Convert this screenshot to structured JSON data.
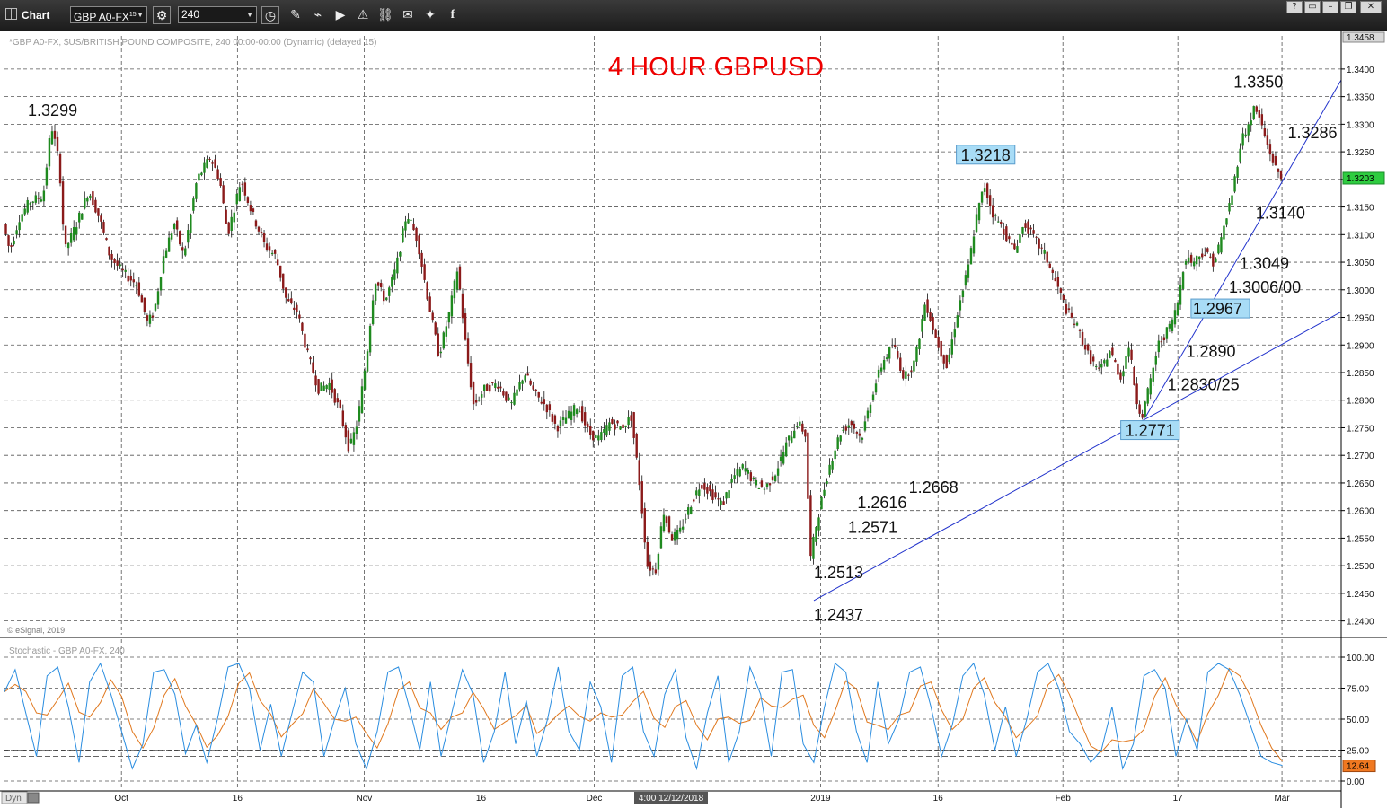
{
  "toolbar": {
    "title": "Chart",
    "symbol": "GBP A0-FX",
    "symbol_superscript": "15",
    "interval": "240",
    "icons": [
      "settings-icon",
      "clock-icon",
      "draw-pencil-icon",
      "line-tool-icon",
      "play-icon",
      "alert-icon",
      "link-icon",
      "comment-icon",
      "twitter-icon",
      "facebook-icon"
    ],
    "window_buttons": [
      "?",
      "▭",
      "–",
      "❐",
      "✕"
    ]
  },
  "chart_data": [
    {
      "type": "candlestick",
      "title": "4 HOUR GBPUSD",
      "subtitle": "*GBP A0-FX, $US/BRITISH POUND COMPOSITE, 240 00:00-00:00 (Dynamic) (delayed 15)",
      "watermark": "© eSignal, 2019",
      "colors": {
        "up": "#1f8a1f",
        "down": "#8b1a1a",
        "title": "#ee0000",
        "trendline": "#2233cc",
        "label_box": "#a8dcf6",
        "last_price_box": "#2ecc40"
      },
      "ylim": [
        1.2375,
        1.346
      ],
      "ticks": [
        "1.2400",
        "1.2450",
        "1.2500",
        "1.2550",
        "1.2600",
        "1.2650",
        "1.2700",
        "1.2750",
        "1.2800",
        "1.2850",
        "1.2900",
        "1.2950",
        "1.3000",
        "1.3050",
        "1.3100",
        "1.3150",
        "1.3200",
        "1.3250",
        "1.3300",
        "1.3350",
        "1.3400"
      ],
      "top_box": "1.3458",
      "last_price": {
        "label": "1.3203",
        "value": 1.3203
      },
      "time_labels": [
        {
          "label": "Oct",
          "t": 0.0875
        },
        {
          "label": "16",
          "t": 0.1743
        },
        {
          "label": "Nov",
          "t": 0.2691
        },
        {
          "label": "16",
          "t": 0.3565
        },
        {
          "label": "Dec",
          "t": 0.4412
        },
        {
          "label": "2019",
          "t": 0.6105
        },
        {
          "label": "16",
          "t": 0.6984
        },
        {
          "label": "Feb",
          "t": 0.7918
        },
        {
          "label": "17",
          "t": 0.8778
        },
        {
          "label": "Mar",
          "t": 0.9557
        }
      ],
      "crosshair_time": "4:00 12/12/2018",
      "price_path": [
        {
          "t": 0.0,
          "p": 1.312
        },
        {
          "t": 0.005,
          "p": 1.307
        },
        {
          "t": 0.012,
          "p": 1.313
        },
        {
          "t": 0.02,
          "p": 1.316
        },
        {
          "t": 0.03,
          "p": 1.317
        },
        {
          "t": 0.036,
          "p": 1.3299
        },
        {
          "t": 0.042,
          "p": 1.323
        },
        {
          "t": 0.046,
          "p": 1.307
        },
        {
          "t": 0.055,
          "p": 1.312
        },
        {
          "t": 0.064,
          "p": 1.318
        },
        {
          "t": 0.072,
          "p": 1.313
        },
        {
          "t": 0.08,
          "p": 1.306
        },
        {
          "t": 0.09,
          "p": 1.303
        },
        {
          "t": 0.1,
          "p": 1.301
        },
        {
          "t": 0.108,
          "p": 1.294
        },
        {
          "t": 0.113,
          "p": 1.296
        },
        {
          "t": 0.12,
          "p": 1.306
        },
        {
          "t": 0.128,
          "p": 1.312
        },
        {
          "t": 0.135,
          "p": 1.306
        },
        {
          "t": 0.145,
          "p": 1.32
        },
        {
          "t": 0.155,
          "p": 1.324
        },
        {
          "t": 0.162,
          "p": 1.32
        },
        {
          "t": 0.168,
          "p": 1.31
        },
        {
          "t": 0.178,
          "p": 1.32
        },
        {
          "t": 0.186,
          "p": 1.314
        },
        {
          "t": 0.196,
          "p": 1.308
        },
        {
          "t": 0.204,
          "p": 1.306
        },
        {
          "t": 0.212,
          "p": 1.298
        },
        {
          "t": 0.22,
          "p": 1.296
        },
        {
          "t": 0.228,
          "p": 1.288
        },
        {
          "t": 0.236,
          "p": 1.282
        },
        {
          "t": 0.244,
          "p": 1.283
        },
        {
          "t": 0.252,
          "p": 1.278
        },
        {
          "t": 0.259,
          "p": 1.271
        },
        {
          "t": 0.265,
          "p": 1.276
        },
        {
          "t": 0.272,
          "p": 1.288
        },
        {
          "t": 0.278,
          "p": 1.302
        },
        {
          "t": 0.286,
          "p": 1.298
        },
        {
          "t": 0.294,
          "p": 1.304
        },
        {
          "t": 0.302,
          "p": 1.314
        },
        {
          "t": 0.31,
          "p": 1.309
        },
        {
          "t": 0.318,
          "p": 1.298
        },
        {
          "t": 0.326,
          "p": 1.288
        },
        {
          "t": 0.334,
          "p": 1.296
        },
        {
          "t": 0.34,
          "p": 1.304
        },
        {
          "t": 0.346,
          "p": 1.29
        },
        {
          "t": 0.352,
          "p": 1.279
        },
        {
          "t": 0.36,
          "p": 1.282
        },
        {
          "t": 0.37,
          "p": 1.283
        },
        {
          "t": 0.38,
          "p": 1.279
        },
        {
          "t": 0.39,
          "p": 1.285
        },
        {
          "t": 0.398,
          "p": 1.281
        },
        {
          "t": 0.406,
          "p": 1.279
        },
        {
          "t": 0.414,
          "p": 1.275
        },
        {
          "t": 0.422,
          "p": 1.277
        },
        {
          "t": 0.43,
          "p": 1.279
        },
        {
          "t": 0.438,
          "p": 1.274
        },
        {
          "t": 0.446,
          "p": 1.273
        },
        {
          "t": 0.454,
          "p": 1.276
        },
        {
          "t": 0.462,
          "p": 1.275
        },
        {
          "t": 0.47,
          "p": 1.277
        },
        {
          "t": 0.476,
          "p": 1.265
        },
        {
          "t": 0.482,
          "p": 1.25
        },
        {
          "t": 0.488,
          "p": 1.249
        },
        {
          "t": 0.494,
          "p": 1.26
        },
        {
          "t": 0.5,
          "p": 1.255
        },
        {
          "t": 0.506,
          "p": 1.256
        },
        {
          "t": 0.514,
          "p": 1.261
        },
        {
          "t": 0.522,
          "p": 1.265
        },
        {
          "t": 0.53,
          "p": 1.263
        },
        {
          "t": 0.538,
          "p": 1.261
        },
        {
          "t": 0.546,
          "p": 1.266
        },
        {
          "t": 0.554,
          "p": 1.268
        },
        {
          "t": 0.562,
          "p": 1.265
        },
        {
          "t": 0.57,
          "p": 1.264
        },
        {
          "t": 0.578,
          "p": 1.267
        },
        {
          "t": 0.586,
          "p": 1.272
        },
        {
          "t": 0.594,
          "p": 1.276
        },
        {
          "t": 0.6,
          "p": 1.274
        },
        {
          "t": 0.604,
          "p": 1.2513
        },
        {
          "t": 0.608,
          "p": 1.2571
        },
        {
          "t": 0.612,
          "p": 1.2616
        },
        {
          "t": 0.618,
          "p": 1.268
        },
        {
          "t": 0.626,
          "p": 1.274
        },
        {
          "t": 0.634,
          "p": 1.276
        },
        {
          "t": 0.642,
          "p": 1.273
        },
        {
          "t": 0.65,
          "p": 1.281
        },
        {
          "t": 0.658,
          "p": 1.287
        },
        {
          "t": 0.666,
          "p": 1.29
        },
        {
          "t": 0.674,
          "p": 1.284
        },
        {
          "t": 0.682,
          "p": 1.287
        },
        {
          "t": 0.69,
          "p": 1.298
        },
        {
          "t": 0.698,
          "p": 1.291
        },
        {
          "t": 0.706,
          "p": 1.286
        },
        {
          "t": 0.714,
          "p": 1.296
        },
        {
          "t": 0.722,
          "p": 1.304
        },
        {
          "t": 0.728,
          "p": 1.313
        },
        {
          "t": 0.734,
          "p": 1.319
        },
        {
          "t": 0.74,
          "p": 1.314
        },
        {
          "t": 0.748,
          "p": 1.311
        },
        {
          "t": 0.756,
          "p": 1.307
        },
        {
          "t": 0.764,
          "p": 1.312
        },
        {
          "t": 0.772,
          "p": 1.309
        },
        {
          "t": 0.78,
          "p": 1.306
        },
        {
          "t": 0.788,
          "p": 1.301
        },
        {
          "t": 0.796,
          "p": 1.296
        },
        {
          "t": 0.804,
          "p": 1.293
        },
        {
          "t": 0.812,
          "p": 1.288
        },
        {
          "t": 0.82,
          "p": 1.285
        },
        {
          "t": 0.828,
          "p": 1.289
        },
        {
          "t": 0.836,
          "p": 1.284
        },
        {
          "t": 0.842,
          "p": 1.29
        },
        {
          "t": 0.848,
          "p": 1.28
        },
        {
          "t": 0.852,
          "p": 1.2771
        },
        {
          "t": 0.858,
          "p": 1.283
        },
        {
          "t": 0.864,
          "p": 1.29
        },
        {
          "t": 0.872,
          "p": 1.293
        },
        {
          "t": 0.878,
          "p": 1.2967
        },
        {
          "t": 0.884,
          "p": 1.306
        },
        {
          "t": 0.89,
          "p": 1.305
        },
        {
          "t": 0.898,
          "p": 1.307
        },
        {
          "t": 0.906,
          "p": 1.3049
        },
        {
          "t": 0.912,
          "p": 1.31
        },
        {
          "t": 0.92,
          "p": 1.318
        },
        {
          "t": 0.926,
          "p": 1.327
        },
        {
          "t": 0.932,
          "p": 1.33
        },
        {
          "t": 0.936,
          "p": 1.333
        },
        {
          "t": 0.94,
          "p": 1.331
        },
        {
          "t": 0.946,
          "p": 1.326
        },
        {
          "t": 0.952,
          "p": 1.322
        },
        {
          "t": 0.956,
          "p": 1.3203
        }
      ],
      "annotations": [
        {
          "text": "1.3299",
          "t": 0.036,
          "p": 1.3299,
          "pos": "above"
        },
        {
          "text": "1.3218",
          "t": 0.734,
          "p": 1.3218,
          "pos": "above",
          "boxed": true
        },
        {
          "text": "1.3350",
          "t": 0.938,
          "p": 1.335,
          "pos": "above"
        },
        {
          "text": "1.3286",
          "t": 0.956,
          "p": 1.3286,
          "pos": "right"
        },
        {
          "text": "1.3140",
          "t": 0.932,
          "p": 1.314,
          "pos": "right"
        },
        {
          "text": "1.3049",
          "t": 0.92,
          "p": 1.3049,
          "pos": "right"
        },
        {
          "text": "1.3006/00",
          "t": 0.912,
          "p": 1.3006,
          "pos": "right"
        },
        {
          "text": "1.2967",
          "t": 0.885,
          "p": 1.2967,
          "pos": "right",
          "boxed": true
        },
        {
          "text": "1.2890",
          "t": 0.88,
          "p": 1.289,
          "pos": "right"
        },
        {
          "text": "1.2830/25",
          "t": 0.866,
          "p": 1.283,
          "pos": "right"
        },
        {
          "text": "1.2771",
          "t": 0.857,
          "p": 1.2771,
          "pos": "below",
          "boxed": true
        },
        {
          "text": "1.2668",
          "t": 0.695,
          "p": 1.2668,
          "pos": "below"
        },
        {
          "text": "1.2616",
          "t": 0.634,
          "p": 1.2616,
          "pos": "right"
        },
        {
          "text": "1.2571",
          "t": 0.627,
          "p": 1.2571,
          "pos": "right"
        },
        {
          "text": "1.2513",
          "t": 0.624,
          "p": 1.2513,
          "pos": "below"
        },
        {
          "text": "1.2437",
          "t": 0.624,
          "p": 1.2437,
          "pos": "below"
        }
      ],
      "trendlines": [
        {
          "t1": 0.6055,
          "p1": 1.2437,
          "t2": 1.0,
          "p2": 1.296
        },
        {
          "t1": 0.854,
          "p1": 1.2771,
          "t2": 1.0,
          "p2": 1.338
        }
      ]
    },
    {
      "type": "line",
      "title": "Stochastic - GBP A0-FX, 240",
      "ylim": [
        0,
        100
      ],
      "ticks": [
        "0.00",
        "25.00",
        "50.00",
        "75.00",
        "100.00"
      ],
      "dashed_levels": [
        25,
        20
      ],
      "last_value": {
        "label": "12.64",
        "value": 12.64
      },
      "series_colors": {
        "k": "#2a8de0",
        "d": "#e0781e"
      },
      "k_values": [
        72,
        90,
        55,
        20,
        85,
        92,
        60,
        15,
        80,
        95,
        70,
        40,
        10,
        30,
        88,
        90,
        70,
        22,
        45,
        15,
        50,
        92,
        95,
        75,
        25,
        62,
        20,
        55,
        88,
        80,
        20,
        50,
        75,
        30,
        10,
        40,
        88,
        92,
        60,
        25,
        80,
        20,
        55,
        90,
        70,
        15,
        40,
        88,
        30,
        65,
        20,
        50,
        92,
        40,
        25,
        80,
        60,
        15,
        85,
        92,
        40,
        20,
        70,
        90,
        35,
        10,
        55,
        85,
        15,
        40,
        92,
        70,
        20,
        88,
        90,
        30,
        15,
        60,
        95,
        88,
        40,
        15,
        80,
        30,
        50,
        88,
        92,
        60,
        20,
        45,
        85,
        95,
        70,
        25,
        60,
        20,
        50,
        88,
        95,
        75,
        40,
        30,
        15,
        25,
        60,
        10,
        30,
        85,
        90,
        75,
        20,
        50,
        25,
        88,
        95,
        90,
        70,
        45,
        20,
        15,
        12.64
      ]
    }
  ],
  "footer": {
    "dyn_label": "Dyn"
  }
}
